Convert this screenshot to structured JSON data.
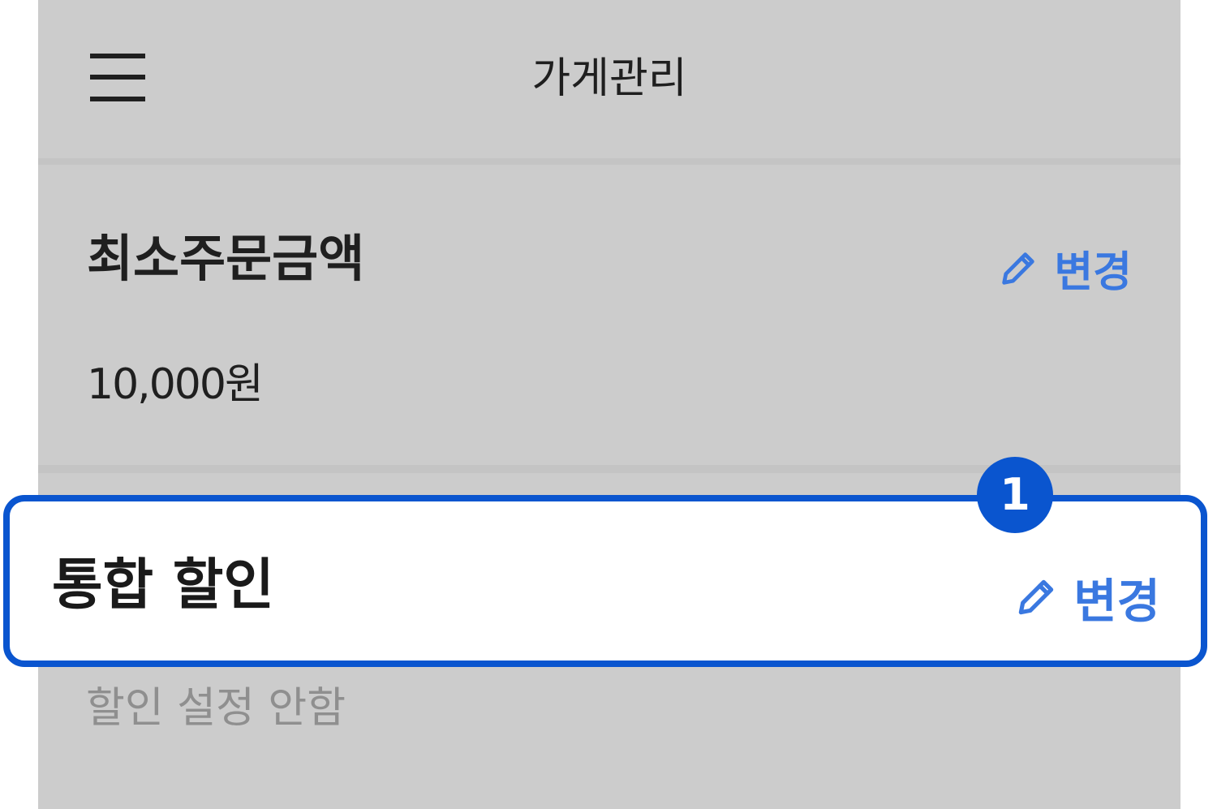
{
  "app": {
    "title": "가게관리"
  },
  "sections": [
    {
      "title": "최소주문금액",
      "edit_label": "변경",
      "value": "10,000원"
    },
    {
      "title": "통합 할인",
      "edit_label": "변경",
      "value": "할인 설정 안함"
    }
  ],
  "callout": {
    "step": "1"
  },
  "icons": {
    "menu": "hamburger-menu-icon",
    "edit": "pencil-icon"
  },
  "colors": {
    "accent": "#3a78e0",
    "highlight_border": "#0a55cf",
    "screen_bg": "#cccccc",
    "subtle_text": "#8f8f8f"
  }
}
